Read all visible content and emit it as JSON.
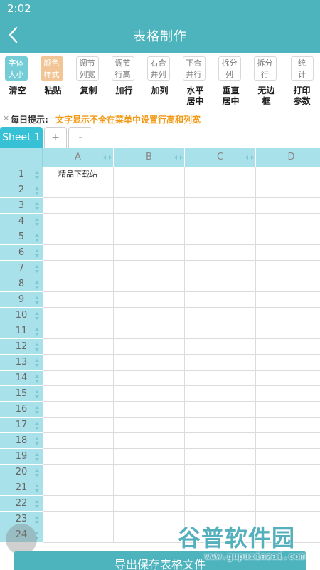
{
  "status": {
    "time": "2:02"
  },
  "appbar": {
    "title": "表格制作"
  },
  "toolbar": {
    "style_buttons": [
      {
        "line1": "字体",
        "line2": "大小"
      },
      {
        "line1": "颜色",
        "line2": "样式"
      },
      {
        "line1": "调节",
        "line2": "列宽"
      },
      {
        "line1": "调节",
        "line2": "行高"
      },
      {
        "line1": "右合",
        "line2": "并列"
      },
      {
        "line1": "下合",
        "line2": "并行"
      },
      {
        "line1": "拆分",
        "line2": "列"
      },
      {
        "line1": "拆分",
        "line2": "行"
      },
      {
        "line1": "统",
        "line2": "计"
      }
    ],
    "action_buttons": [
      {
        "line1": "清空",
        "line2": ""
      },
      {
        "line1": "粘贴",
        "line2": ""
      },
      {
        "line1": "复制",
        "line2": ""
      },
      {
        "line1": "加行",
        "line2": ""
      },
      {
        "line1": "加列",
        "line2": ""
      },
      {
        "line1": "水平",
        "line2": "居中"
      },
      {
        "line1": "垂直",
        "line2": "居中"
      },
      {
        "line1": "无边",
        "line2": "框"
      },
      {
        "line1": "打印",
        "line2": "参数"
      }
    ]
  },
  "tip": {
    "close": "×",
    "lead": "每日提示:",
    "message": "文字显示不全在菜单中设置行高和列宽"
  },
  "tabs": {
    "active": "Sheet 1",
    "add": "+",
    "remove": "-"
  },
  "grid": {
    "columns": [
      "A",
      "B",
      "C",
      "D"
    ],
    "rows": [
      "1",
      "2",
      "3",
      "4",
      "5",
      "6",
      "7",
      "8",
      "9",
      "10",
      "11",
      "12",
      "13",
      "14",
      "15",
      "16",
      "17",
      "18",
      "19",
      "20",
      "21",
      "22",
      "23",
      "24"
    ],
    "cells": {
      "A1": "精品下载站"
    }
  },
  "bottom_button": {
    "label": "导出保存表格文件"
  },
  "watermark": {
    "brand": "谷普软件园",
    "url": "www.gupuxiazai.com"
  },
  "colors": {
    "primary": "#4db3bd",
    "tab_active": "#36c1d6",
    "header": "#a9e1ea",
    "tip_text": "#f29a16"
  }
}
